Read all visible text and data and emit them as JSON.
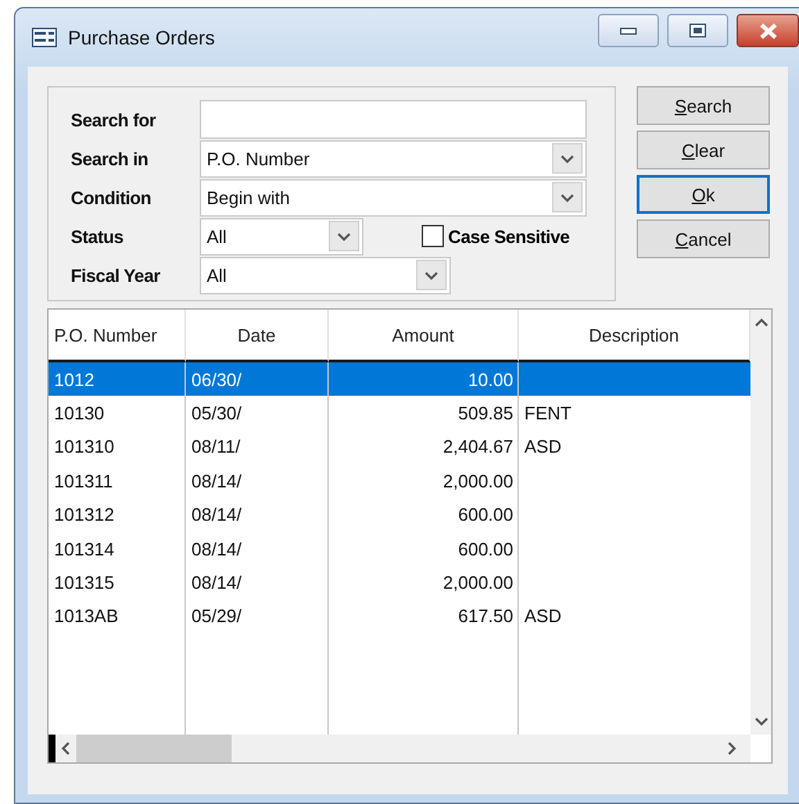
{
  "window": {
    "title": "Purchase Orders"
  },
  "search_form": {
    "fields": [
      {
        "label": "Search for",
        "kind": "text"
      },
      {
        "label": "Search in",
        "kind": "dropdown",
        "value": "P.O. Number"
      },
      {
        "label": "Condition",
        "kind": "dropdown",
        "value": "Begin with"
      },
      {
        "label": "Status",
        "kind": "dropdown",
        "value": "All"
      },
      {
        "label": "Fiscal Year",
        "kind": "dropdown",
        "value": "All"
      }
    ],
    "case_sensitive": {
      "label": "Case Sensitive",
      "checked": false
    }
  },
  "buttons": [
    {
      "label": "Search",
      "focused": false
    },
    {
      "label": "Clear",
      "focused": false
    },
    {
      "label": "Ok",
      "focused": true
    },
    {
      "label": "Cancel",
      "focused": false
    }
  ],
  "table": {
    "columns": [
      "P.O. Number",
      "Date",
      "Amount",
      "Description"
    ],
    "rows": [
      {
        "po_number": "1012",
        "date": "06/30/",
        "amount": "10.00",
        "selected": true
      },
      {
        "po_number": "10130",
        "date": "05/30/",
        "amount": "509.85",
        "description": "FENT",
        "selected": false
      },
      {
        "po_number": "101310",
        "date": "08/11/",
        "amount": "2,404.67",
        "description": "ASD",
        "selected": false
      },
      {
        "po_number": "101311",
        "date": "08/14/",
        "amount": "2,000.00",
        "selected": false
      },
      {
        "po_number": "101312",
        "date": "08/14/",
        "amount": "600.00",
        "selected": false
      },
      {
        "po_number": "101314",
        "date": "08/14/",
        "amount": "600.00",
        "selected": false
      },
      {
        "po_number": "101315",
        "date": "08/14/",
        "amount": "2,000.00",
        "selected": false
      },
      {
        "po_number": "1013AB",
        "date": "05/29/",
        "amount": "617.50",
        "description": "ASD",
        "selected": false
      }
    ]
  }
}
